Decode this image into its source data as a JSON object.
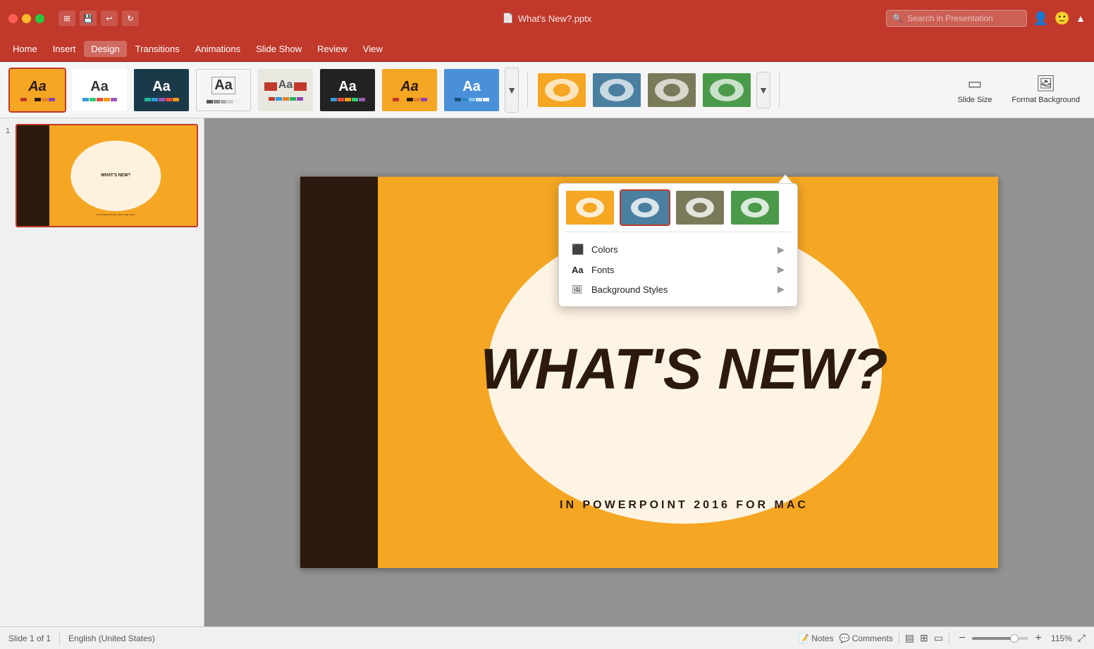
{
  "window": {
    "title": "What's New?.pptx",
    "file_icon": "📄"
  },
  "traffic_lights": {
    "close": "close",
    "minimize": "minimize",
    "maximize": "maximize"
  },
  "title_bar": {
    "title": "What's New?.pptx",
    "search_placeholder": "Search in Presentation"
  },
  "menu": {
    "items": [
      {
        "id": "home",
        "label": "Home"
      },
      {
        "id": "insert",
        "label": "Insert"
      },
      {
        "id": "design",
        "label": "Design"
      },
      {
        "id": "transitions",
        "label": "Transitions"
      },
      {
        "id": "animations",
        "label": "Animations"
      },
      {
        "id": "slideshow",
        "label": "Slide Show"
      },
      {
        "id": "review",
        "label": "Review"
      },
      {
        "id": "view",
        "label": "View"
      }
    ],
    "active": "design"
  },
  "ribbon": {
    "themes": [
      {
        "id": "t1",
        "bg": "#f5a623",
        "text_color": "#2c1a0e",
        "selected": true
      },
      {
        "id": "t2",
        "bg": "#ffffff",
        "text_color": "#333",
        "selected": false
      },
      {
        "id": "t3",
        "bg": "#1a3a4a",
        "text_color": "#ffffff",
        "selected": false
      },
      {
        "id": "t4",
        "bg": "#f5f5f5",
        "text_color": "#333",
        "selected": false,
        "border": true
      },
      {
        "id": "t5",
        "bg": "#e8e8e0",
        "text_color": "#555",
        "selected": false
      },
      {
        "id": "t6",
        "bg": "#222222",
        "text_color": "#ffffff",
        "selected": false
      },
      {
        "id": "t7",
        "bg": "#f5a623",
        "text_color": "#2c1a0e",
        "selected": false
      },
      {
        "id": "t8",
        "bg": "#4a90d9",
        "text_color": "#ffffff",
        "selected": false
      }
    ],
    "variants": [
      {
        "id": "v1",
        "bg": "#f5a623"
      },
      {
        "id": "v2",
        "bg": "#4a90d9"
      },
      {
        "id": "v3",
        "bg": "#7a7a5a"
      },
      {
        "id": "v4",
        "bg": "#4a9a4a"
      }
    ],
    "buttons": [
      {
        "id": "slide-size",
        "label": "Slide\nSize",
        "icon": "▭"
      },
      {
        "id": "format-background",
        "label": "Format\nBackground",
        "icon": "🖼"
      }
    ]
  },
  "slide": {
    "title": "WHAT'S NEW?",
    "subtitle": "IN POWERPOINT 2016 FOR MAC",
    "number": "1"
  },
  "dropdown": {
    "themes": [
      {
        "id": "dv1",
        "bg": "#f5a623",
        "selected": false
      },
      {
        "id": "dv2",
        "bg": "#4a90d9",
        "selected": true
      },
      {
        "id": "dv3",
        "bg": "#7a7a5a",
        "selected": false
      },
      {
        "id": "dv4",
        "bg": "#4a9a4a",
        "selected": false
      }
    ],
    "options": [
      {
        "id": "colors",
        "label": "Colors",
        "icon": "🎨"
      },
      {
        "id": "fonts",
        "label": "Fonts",
        "icon": "Aa"
      },
      {
        "id": "background",
        "label": "Background Styles",
        "icon": "⬜"
      }
    ]
  },
  "status_bar": {
    "slide_info": "Slide 1 of 1",
    "language": "English (United States)",
    "notes_label": "Notes",
    "comments_label": "Comments",
    "zoom_level": "115%"
  }
}
